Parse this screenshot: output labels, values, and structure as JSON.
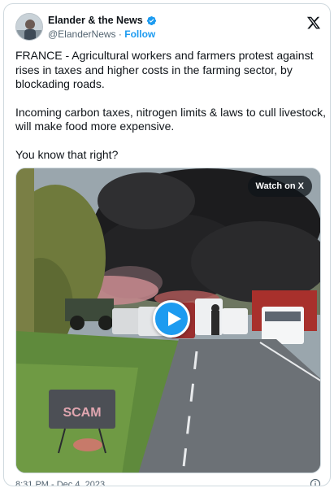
{
  "author": {
    "name": "Elander & the News",
    "handle": "@ElanderNews",
    "separator": "·",
    "follow_label": "Follow",
    "verified_icon": "verified-badge-icon"
  },
  "brand_icon": "x-logo-icon",
  "tweet": {
    "paragraphs": [
      "FRANCE - Agricultural workers and farmers protest against rises in taxes and higher costs in the farming sector, by blockading roads.",
      "Incoming carbon taxes, nitrogen limits & laws to cull livestock, will make food more expensive.",
      "You know that right?"
    ]
  },
  "media": {
    "watch_label": "Watch on X",
    "play_icon": "play-icon",
    "sign_text": "SCAM"
  },
  "footer": {
    "timestamp": "8:31 PM - Dec 4, 2023",
    "info_icon": "info-icon"
  },
  "colors": {
    "accent": "#1d9bf0",
    "text": "#0f1419",
    "muted": "#536471",
    "border": "#cfd9de"
  }
}
